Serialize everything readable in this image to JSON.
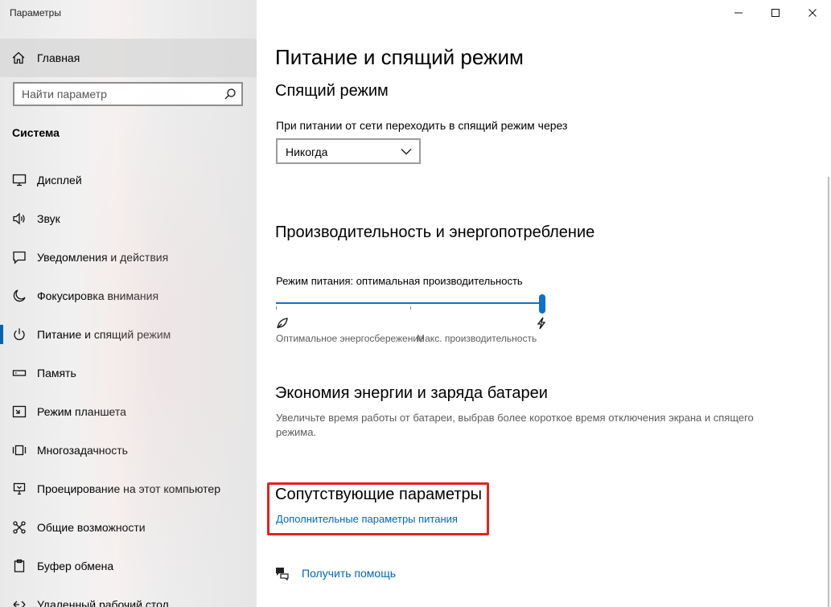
{
  "window": {
    "title": "Параметры"
  },
  "sidebar": {
    "home_label": "Главная",
    "search_placeholder": "Найти параметр",
    "section_title": "Система",
    "items": [
      {
        "label": "Дисплей",
        "icon": "display-icon"
      },
      {
        "label": "Звук",
        "icon": "speaker-icon"
      },
      {
        "label": "Уведомления и действия",
        "icon": "notification-icon"
      },
      {
        "label": "Фокусировка внимания",
        "icon": "moon-icon"
      },
      {
        "label": "Питание и спящий режим",
        "icon": "power-icon",
        "active": true
      },
      {
        "label": "Память",
        "icon": "storage-icon"
      },
      {
        "label": "Режим планшета",
        "icon": "tablet-icon"
      },
      {
        "label": "Многозадачность",
        "icon": "multitasking-icon"
      },
      {
        "label": "Проецирование на этот компьютер",
        "icon": "projecting-icon"
      },
      {
        "label": "Общие возможности",
        "icon": "shared-experiences-icon"
      },
      {
        "label": "Буфер обмена",
        "icon": "clipboard-icon"
      },
      {
        "label": "Удаленный рабочий стол",
        "icon": "remote-desktop-icon"
      }
    ]
  },
  "main": {
    "title": "Питание и спящий режим",
    "sleep": {
      "heading": "Спящий режим",
      "label": "При питании от сети переходить в спящий режим через",
      "value": "Никогда"
    },
    "performance": {
      "heading": "Производительность и энергопотребление",
      "mode_label": "Режим питания: оптимальная производительность",
      "slider_value_fraction": 1.0,
      "left_label": "Оптимальное энергосбережение",
      "right_label": "Макс. производительность"
    },
    "battery": {
      "heading": "Экономия энергии и заряда батареи",
      "description_line1": "Увеличьте время работы от батареи, выбрав более короткое время отключения экрана и спящего",
      "description_line2": "режима."
    },
    "related": {
      "heading": "Сопутствующие параметры",
      "link": "Дополнительные параметры питания",
      "highlight_color": "#e32222"
    },
    "help": {
      "link": "Получить помощь"
    }
  },
  "colors": {
    "accent": "#0067b8",
    "slider": "#0a73c9"
  }
}
